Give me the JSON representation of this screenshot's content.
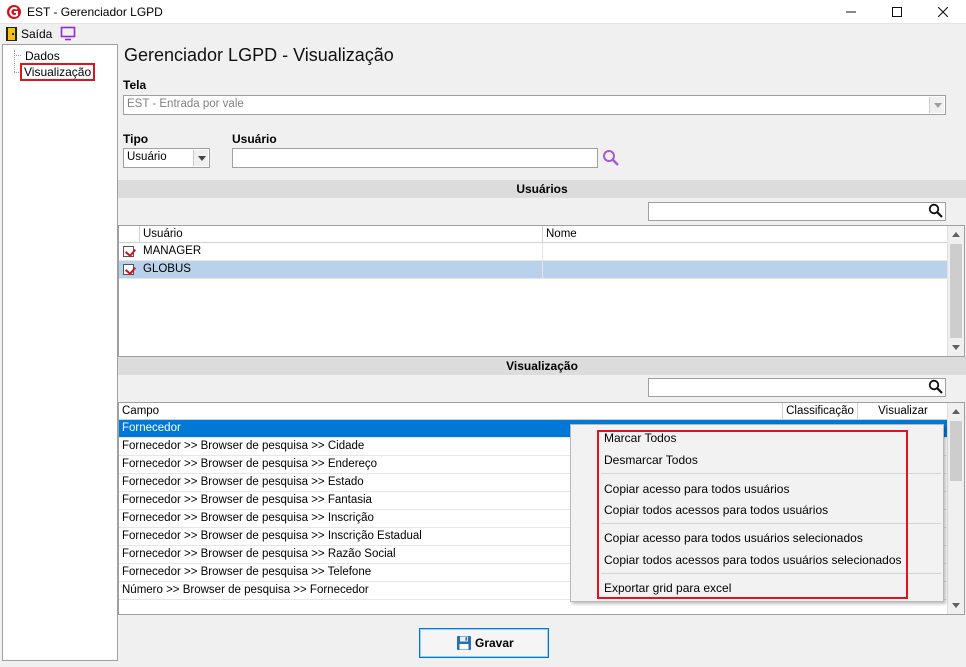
{
  "window": {
    "title": "EST - Gerenciador LGPD"
  },
  "menu": {
    "exit_label": "Saída"
  },
  "tree": {
    "items": [
      {
        "label": "Dados"
      },
      {
        "label": "Visualização"
      }
    ]
  },
  "page": {
    "title": "Gerenciador LGPD - Visualização"
  },
  "form": {
    "tela_label": "Tela",
    "tela_value": "EST - Entrada por vale",
    "tipo_label": "Tipo",
    "tipo_value": "Usuário",
    "usuario_label": "Usuário",
    "usuario_value": ""
  },
  "users": {
    "header": "Usuários",
    "search_value": "",
    "columns": [
      "Usuário",
      "Nome"
    ],
    "rows": [
      {
        "usuario": "MANAGER",
        "nome": "",
        "checked": true
      },
      {
        "usuario": "GLOBUS",
        "nome": "",
        "checked": true
      }
    ]
  },
  "visualizacao": {
    "header": "Visualização",
    "search_value": "",
    "columns": [
      "Campo",
      "Classificação",
      "Visualizar"
    ],
    "rows": [
      "Fornecedor",
      "Fornecedor >> Browser de pesquisa >> Cidade",
      "Fornecedor >> Browser de pesquisa >> Endereço",
      "Fornecedor >> Browser de pesquisa >> Estado",
      "Fornecedor >> Browser de pesquisa >> Fantasia",
      "Fornecedor >> Browser de pesquisa >> Inscrição",
      "Fornecedor >> Browser de pesquisa >> Inscrição Estadual",
      "Fornecedor >> Browser de pesquisa >> Razão Social",
      "Fornecedor >> Browser de pesquisa >> Telefone",
      "Número >> Browser de pesquisa >> Fornecedor"
    ]
  },
  "context_menu": {
    "items": [
      "Marcar Todos",
      "Desmarcar Todos",
      "Copiar acesso para todos usuários",
      "Copiar todos acessos para todos usuários",
      "Copiar acesso para todos usuários selecionados",
      "Copiar todos acessos para todos usuários selecionados",
      "Exportar grid para excel"
    ]
  },
  "buttons": {
    "save_label": "Gravar"
  },
  "colors": {
    "accent": "#0078d7",
    "highlight_box": "#e0141e",
    "selected_row": "#b9d1ea"
  }
}
